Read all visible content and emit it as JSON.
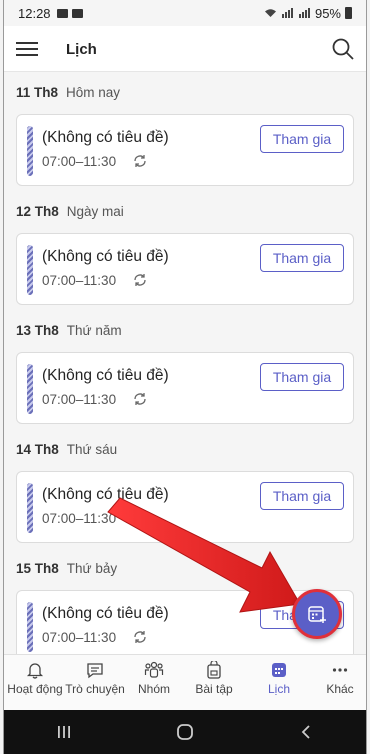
{
  "status_bar": {
    "time": "12:28",
    "battery": "95%"
  },
  "app_bar": {
    "title": "Lịch"
  },
  "days": [
    {
      "date": "11 Th8",
      "label": "Hôm nay",
      "event": {
        "title": "(Không có tiêu đề)",
        "time": "07:00–11:30",
        "join": "Tham gia"
      }
    },
    {
      "date": "12 Th8",
      "label": "Ngày mai",
      "event": {
        "title": "(Không có tiêu đề)",
        "time": "07:00–11:30",
        "join": "Tham gia"
      }
    },
    {
      "date": "13 Th8",
      "label": "Thứ năm",
      "event": {
        "title": "(Không có tiêu đề)",
        "time": "07:00–11:30",
        "join": "Tham gia"
      }
    },
    {
      "date": "14 Th8",
      "label": "Thứ sáu",
      "event": {
        "title": "(Không có tiêu đề)",
        "time": "07:00–11:30",
        "join": "Tham gia"
      }
    },
    {
      "date": "15 Th8",
      "label": "Thứ bảy",
      "event": {
        "title": "(Không có tiêu đề)",
        "time": "07:00–11:30",
        "join": "Tham gia"
      }
    }
  ],
  "bottom_nav": {
    "items": [
      {
        "label": "Hoạt động",
        "icon": "bell-icon"
      },
      {
        "label": "Trò chuyện",
        "icon": "chat-icon"
      },
      {
        "label": "Nhóm",
        "icon": "teams-icon"
      },
      {
        "label": "Bài tập",
        "icon": "assignments-icon"
      },
      {
        "label": "Lịch",
        "icon": "calendar-icon",
        "active": true
      },
      {
        "label": "Khác",
        "icon": "more-icon"
      }
    ]
  },
  "fab": {
    "icon": "new-meeting-icon"
  },
  "colors": {
    "accent": "#5b5fc7",
    "annotation_arrow": "#e0303a"
  }
}
